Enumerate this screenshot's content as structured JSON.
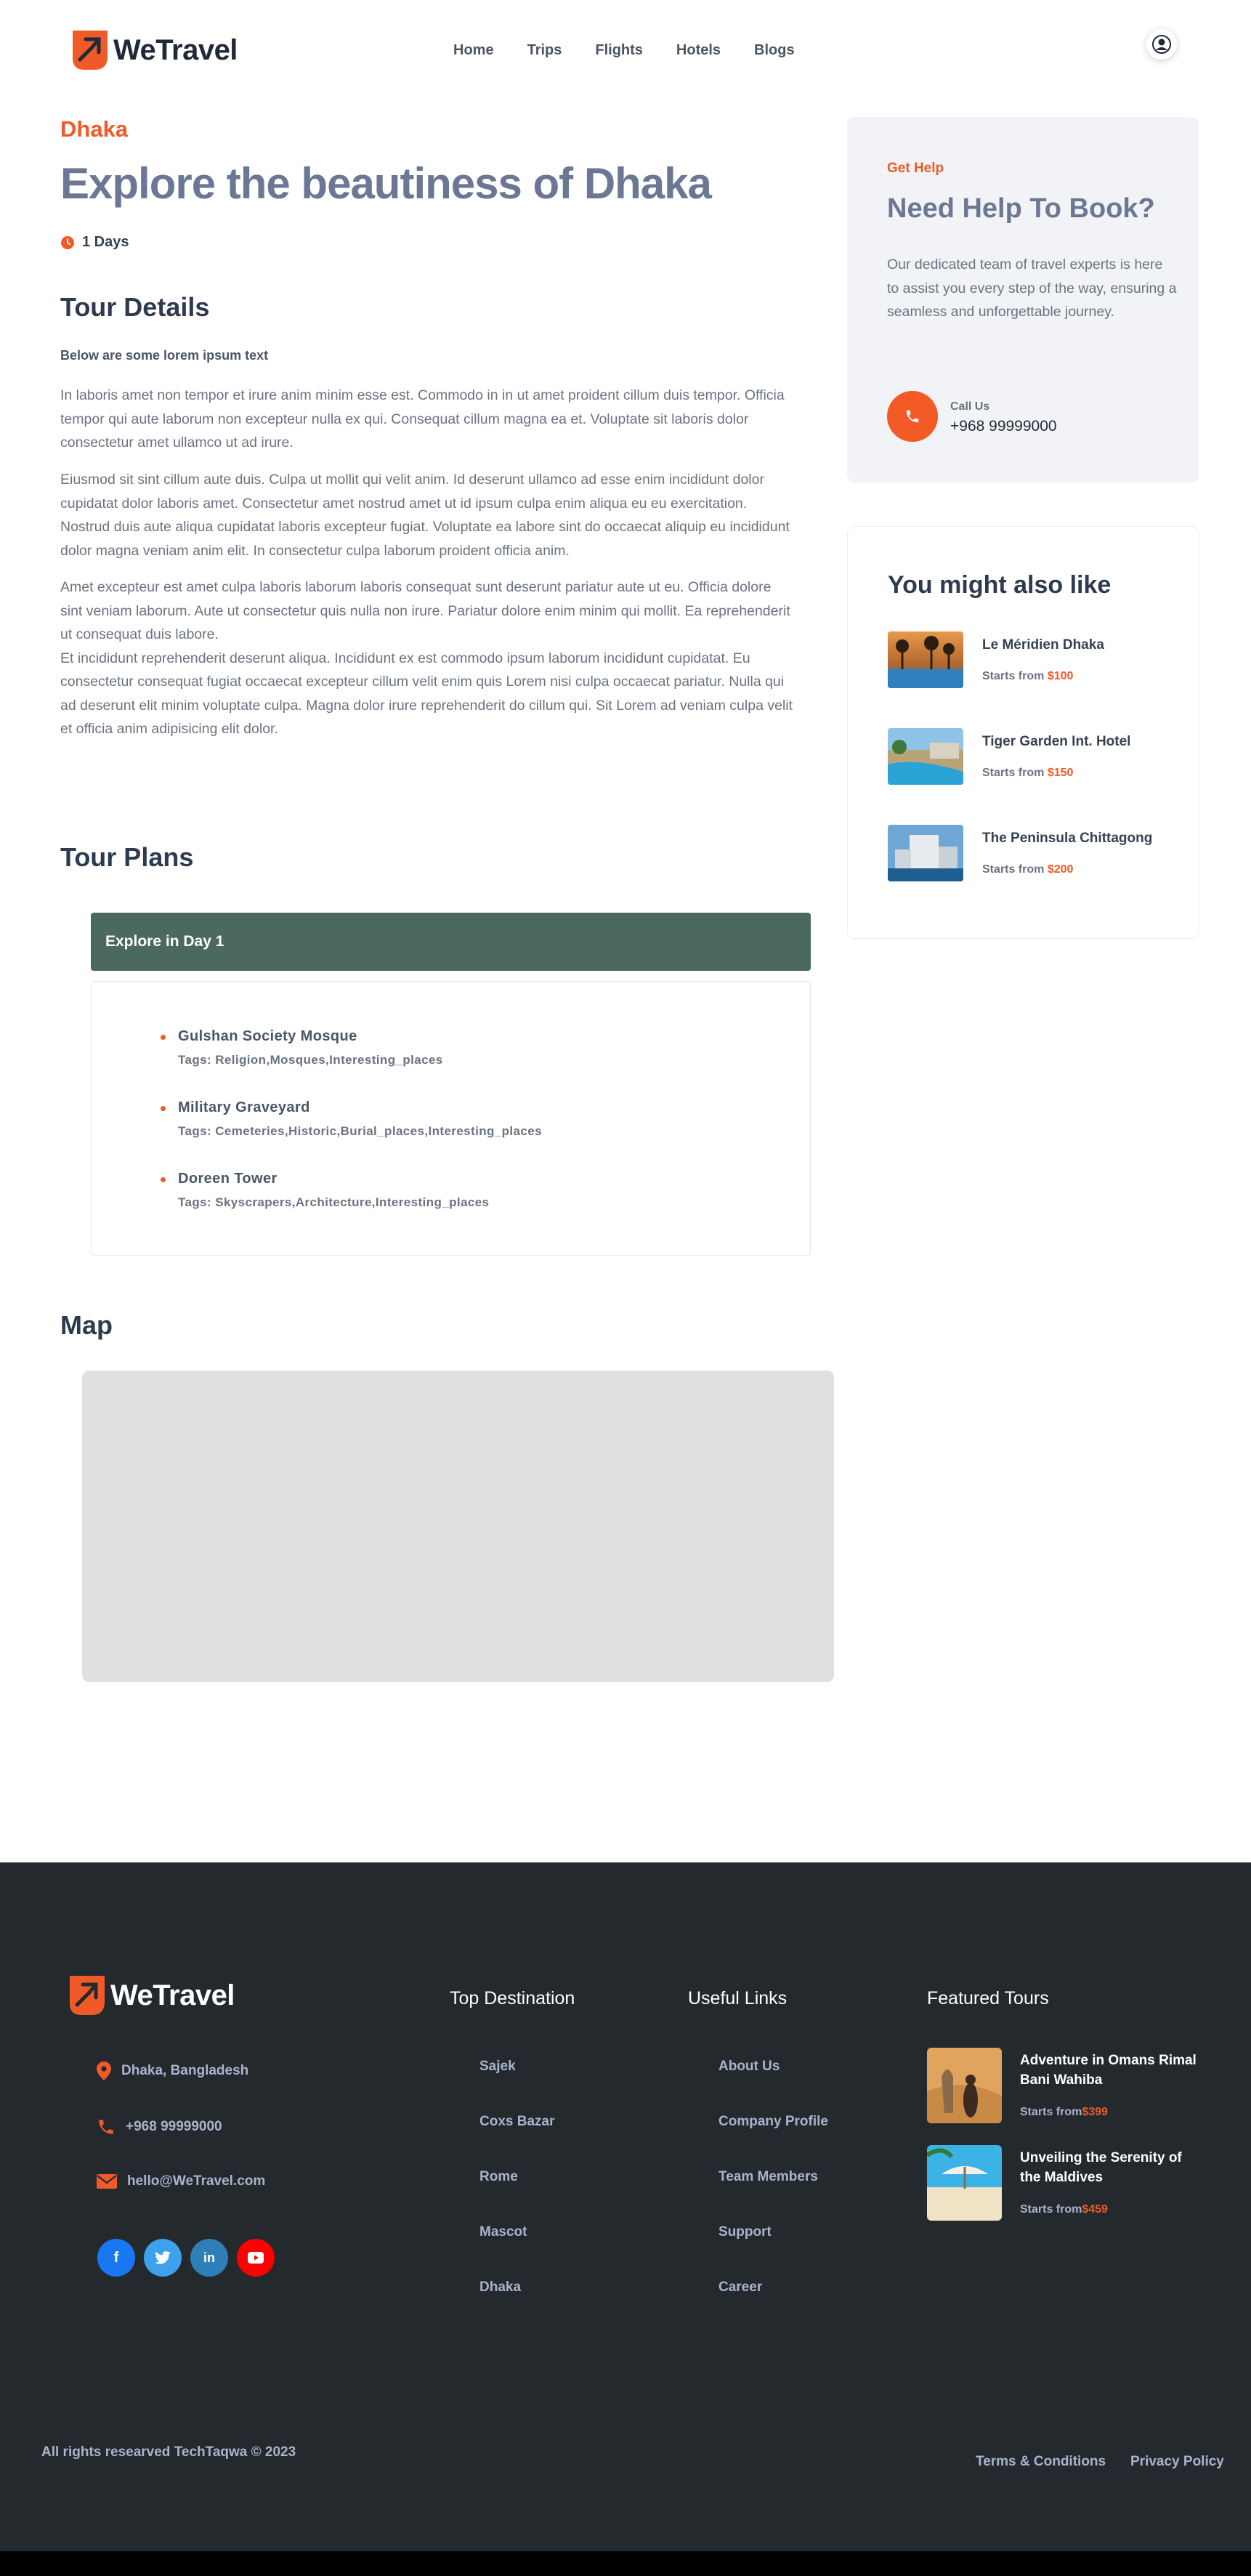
{
  "brand": {
    "name": "WeTravel",
    "accent": "#f05a28"
  },
  "nav": {
    "items": [
      "Home",
      "Trips",
      "Flights",
      "Hotels",
      "Blogs"
    ],
    "profile_icon": "user-circle-icon"
  },
  "tour": {
    "city": "Dhaka",
    "title": "Explore the beautiness of Dhaka",
    "duration": "1 Days",
    "details_heading": "Tour Details",
    "details_subheading": "Below are some lorem ipsum text",
    "paragraphs": [
      "In laboris amet non tempor et irure anim minim esse est. Commodo in in ut amet proident cillum duis tempor. Officia tempor qui aute laborum non excepteur nulla ex qui. Consequat cillum magna ea et. Voluptate sit laboris dolor consectetur amet ullamco ut ad irure.",
      "Eiusmod sit sint cillum aute duis. Culpa ut mollit qui velit anim. Id deserunt ullamco ad esse enim incididunt dolor cupidatat dolor laboris amet. Consectetur amet nostrud amet ut id ipsum culpa enim aliqua eu eu exercitation. Nostrud duis aute aliqua cupidatat laboris excepteur fugiat. Voluptate ea labore sint do occaecat aliquip eu incididunt dolor magna veniam anim elit. In consectetur culpa laborum proident officia anim.",
      "Amet excepteur est amet culpa laboris laborum laboris consequat sunt deserunt pariatur aute ut eu. Officia dolore sint veniam laborum. Aute ut consectetur quis nulla non irure. Pariatur dolore enim minim qui mollit. Ea reprehenderit ut consequat duis labore.\nEt incididunt reprehenderit deserunt aliqua. Incididunt ex est commodo ipsum laborum incididunt cupidatat. Eu consectetur consequat fugiat occaecat excepteur cillum velit enim quis Lorem nisi culpa occaecat pariatur. Nulla qui ad deserunt elit minim voluptate culpa. Magna dolor irure reprehenderit do cillum qui. Sit Lorem ad veniam culpa velit et officia anim adipisicing elit dolor."
    ],
    "plans_heading": "Tour Plans",
    "day": {
      "title": "Explore in Day 1",
      "places": [
        {
          "name": "Gulshan Society Mosque",
          "tags": "Tags: Religion,Mosques,Interesting_places"
        },
        {
          "name": "Military Graveyard",
          "tags": "Tags: Cemeteries,Historic,Burial_places,Interesting_places"
        },
        {
          "name": "Doreen Tower",
          "tags": "Tags: Skyscrapers,Architecture,Interesting_places"
        }
      ]
    },
    "map_heading": "Map"
  },
  "help": {
    "kicker": "Get Help",
    "title": "Need Help To Book?",
    "description": "Our dedicated team of travel experts is here to assist you every step of the way, ensuring a seamless and unforgettable journey.",
    "call_label": "Call Us",
    "phone": "+968 99999000"
  },
  "also_like": {
    "title": "You might also like",
    "starts_from": "Starts from",
    "items": [
      {
        "name": "Le Méridien Dhaka",
        "price": "$100"
      },
      {
        "name": "Tiger Garden Int. Hotel",
        "price": "$150"
      },
      {
        "name": "The Peninsula Chittagong",
        "price": "$200"
      }
    ]
  },
  "footer": {
    "brand": "WeTravel",
    "address": "Dhaka, Bangladesh",
    "phone": "+968 99999000",
    "email": "hello@WeTravel.com",
    "socials": [
      "facebook-icon",
      "twitter-icon",
      "linkedin-icon",
      "youtube-icon"
    ],
    "top_destination": {
      "heading": "Top Destination",
      "links": [
        "Sajek",
        "Coxs Bazar",
        "Rome",
        "Mascot",
        "Dhaka"
      ]
    },
    "useful_links": {
      "heading": "Useful Links",
      "links": [
        "About Us",
        "Company Profile",
        "Team Members",
        "Support",
        "Career"
      ]
    },
    "featured_tours": {
      "heading": "Featured Tours",
      "starts_from": "Starts from",
      "items": [
        {
          "name": "Adventure in Omans Rimal Bani Wahiba",
          "price": "$399"
        },
        {
          "name": "Unveiling the Serenity of the Maldives",
          "price": "$459"
        }
      ]
    },
    "copyright": "All rights researved TechTaqwa © 2023",
    "terms": "Terms & Conditions",
    "privacy": "Privacy Policy"
  }
}
